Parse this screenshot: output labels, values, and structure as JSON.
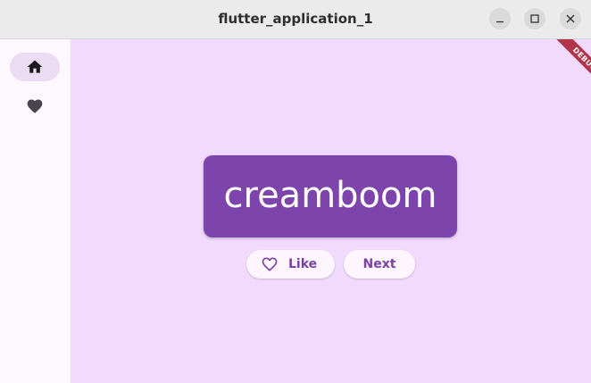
{
  "window": {
    "title": "flutter_application_1",
    "controls": {
      "minimize_icon": "minimize-icon",
      "maximize_icon": "maximize-icon",
      "close_icon": "close-icon"
    }
  },
  "sidebar": {
    "items": [
      {
        "icon": "home-icon",
        "selected": true
      },
      {
        "icon": "heart-filled-icon",
        "selected": false
      }
    ]
  },
  "main": {
    "word": "creamboom",
    "like_button": {
      "icon": "heart-outline-icon",
      "label": "Like"
    },
    "next_button": {
      "label": "Next"
    }
  },
  "debug_banner": {
    "label": "DEBUG"
  },
  "colors": {
    "background": "#f1dafd",
    "sidebar": "#fdf7ff",
    "selected_indicator": "#ecdcf3",
    "card": "#7d44ab",
    "button_text": "#7b3fa8",
    "banner": "#b0354b"
  }
}
